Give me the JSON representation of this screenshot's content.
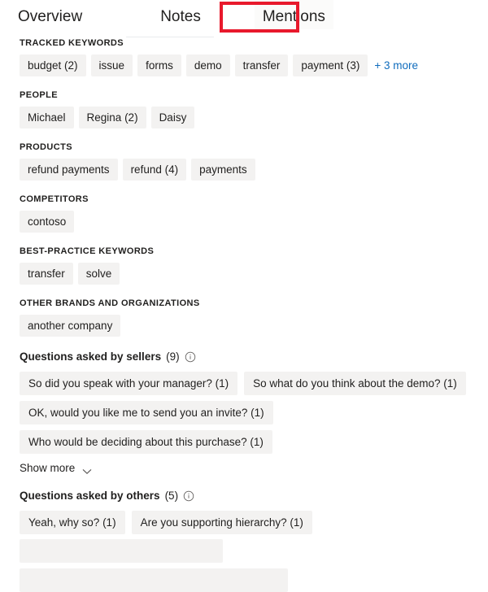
{
  "tabs": [
    {
      "label": "Overview",
      "selected": false
    },
    {
      "label": "Notes",
      "selected": false
    },
    {
      "label": "Mentions",
      "selected": true
    }
  ],
  "highlight": {
    "color": "#e8192c",
    "target": "Mentions"
  },
  "link_color": "#0f6cbd",
  "chip_bg": "#f3f2f1",
  "sections": [
    {
      "title": "TRACKED KEYWORDS",
      "chips": [
        "budget (2)",
        "issue",
        "forms",
        "demo",
        "transfer",
        "payment (3)"
      ],
      "more_label": "+ 3 more"
    },
    {
      "title": "PEOPLE",
      "chips": [
        "Michael",
        "Regina (2)",
        "Daisy"
      ],
      "more_label": ""
    },
    {
      "title": "PRODUCTS",
      "chips": [
        "refund payments",
        "refund (4)",
        "payments"
      ],
      "more_label": ""
    },
    {
      "title": "COMPETITORS",
      "chips": [
        "contoso"
      ],
      "more_label": ""
    },
    {
      "title": "BEST-PRACTICE KEYWORDS",
      "chips": [
        "transfer",
        "solve"
      ],
      "more_label": ""
    },
    {
      "title": "OTHER BRANDS AND ORGANIZATIONS",
      "chips": [
        "another company"
      ],
      "more_label": ""
    }
  ],
  "questions_sellers": {
    "label": "Questions asked by sellers",
    "count": "(9)",
    "info_icon": "info-circle-icon",
    "chips": [
      "So did you speak with your manager? (1)",
      "So what do you think about the demo? (1)",
      "OK, would you like me to send you an invite? (1)",
      "Who would be deciding about this purchase? (1)"
    ],
    "show_more_label": "Show more",
    "chevron_icon": "chevron-down-icon"
  },
  "questions_others": {
    "label": "Questions asked by others",
    "count": "(5)",
    "info_icon": "info-circle-icon",
    "chips": [
      "Yeah, why so? (1)",
      "Are you supporting hierarchy? (1)"
    ],
    "chips_cut_off": [
      "",
      ""
    ]
  }
}
